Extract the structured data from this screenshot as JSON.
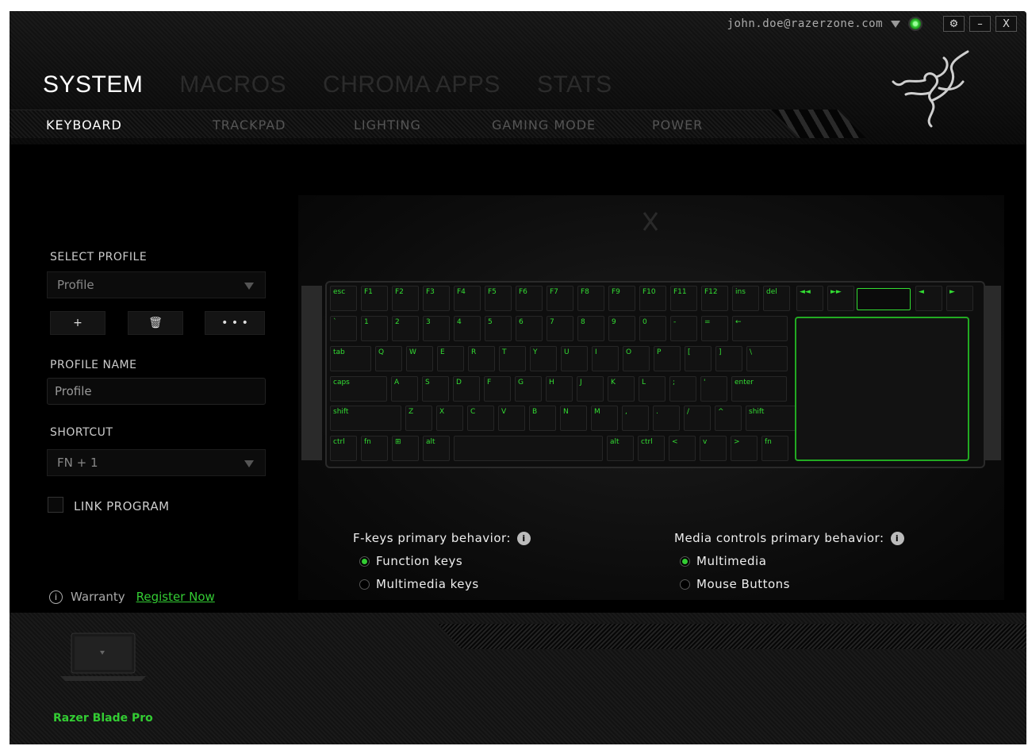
{
  "account": {
    "email": "john.doe@razerzone.com"
  },
  "window_controls": {
    "settings": "⚙",
    "minimize": "–",
    "close": "X"
  },
  "main_tabs": [
    {
      "label": "SYSTEM",
      "active": true
    },
    {
      "label": "MACROS",
      "active": false
    },
    {
      "label": "CHROMA APPS",
      "active": false
    },
    {
      "label": "STATS",
      "active": false
    }
  ],
  "sub_tabs": [
    {
      "label": "KEYBOARD",
      "active": true
    },
    {
      "label": "TRACKPAD",
      "active": false
    },
    {
      "label": "LIGHTING",
      "active": false
    },
    {
      "label": "GAMING MODE",
      "active": false
    },
    {
      "label": "POWER",
      "active": false
    }
  ],
  "profile": {
    "select_label": "SELECT PROFILE",
    "selected": "Profile",
    "add": "+",
    "delete": "🗑",
    "more": "• • •",
    "name_label": "PROFILE NAME",
    "name_value": "Profile",
    "shortcut_label": "SHORTCUT",
    "shortcut_value": "FN + 1",
    "link_program": "LINK PROGRAM"
  },
  "warranty": {
    "label": "Warranty",
    "link": "Register Now"
  },
  "fkeys": {
    "title": "F-keys primary behavior:",
    "options": [
      {
        "label": "Function keys",
        "selected": true
      },
      {
        "label": "Multimedia keys",
        "selected": false
      }
    ]
  },
  "media": {
    "title": "Media controls primary behavior:",
    "options": [
      {
        "label": "Multimedia",
        "selected": true
      },
      {
        "label": "Mouse Buttons",
        "selected": false
      }
    ]
  },
  "device": {
    "name": "Razer Blade Pro"
  },
  "keyboard_rows": [
    [
      "esc",
      "F1",
      "F2",
      "F3",
      "F4",
      "F5",
      "F6",
      "F7",
      "F8",
      "F9",
      "F10",
      "F11",
      "F12",
      "ins",
      "del"
    ],
    [
      "`",
      "1",
      "2",
      "3",
      "4",
      "5",
      "6",
      "7",
      "8",
      "9",
      "0",
      "-",
      "="
    ],
    [
      "tab",
      "Q",
      "W",
      "E",
      "R",
      "T",
      "Y",
      "U",
      "I",
      "O",
      "P",
      "[",
      "]",
      "\\"
    ],
    [
      "caps",
      "A",
      "S",
      "D",
      "F",
      "G",
      "H",
      "J",
      "K",
      "L",
      ";",
      "'",
      "enter"
    ],
    [
      "shift",
      "Z",
      "X",
      "C",
      "V",
      "B",
      "N",
      "M",
      ",",
      ".",
      "/",
      "^",
      "shift"
    ],
    [
      "ctrl",
      "fn",
      "⊞",
      "alt",
      "alt",
      "ctrl",
      "<",
      "v",
      ">",
      "fn"
    ]
  ],
  "accent_color": "#33cc33"
}
